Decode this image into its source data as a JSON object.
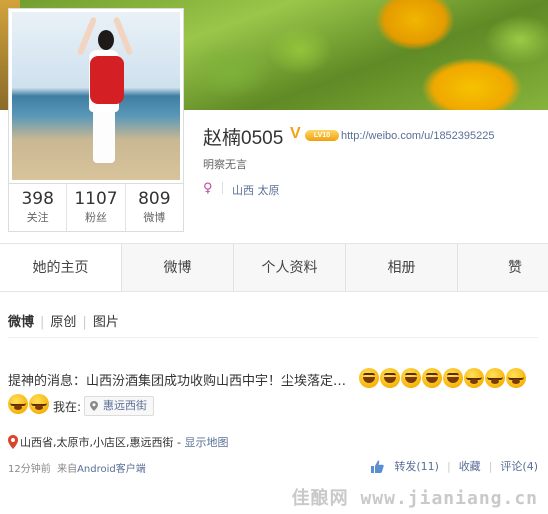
{
  "profile": {
    "username": "赵楠0505",
    "verified_mark": "V",
    "level_badge": "LV10",
    "url": "http://weibo.com/u/1852395225",
    "bio": "明察无言",
    "location": "山西 太原",
    "gender_icon": "female-icon"
  },
  "stats": [
    {
      "value": "398",
      "label": "关注"
    },
    {
      "value": "1107",
      "label": "粉丝"
    },
    {
      "value": "809",
      "label": "微博"
    }
  ],
  "tabs": [
    {
      "label": "她的主页",
      "active": true
    },
    {
      "label": "微博",
      "active": false
    },
    {
      "label": "个人资料",
      "active": false
    },
    {
      "label": "相册",
      "active": false
    },
    {
      "label": "赞",
      "active": false
    }
  ],
  "subtabs": [
    {
      "label": "微博",
      "active": true
    },
    {
      "label": "原创",
      "active": false
    },
    {
      "label": "图片",
      "active": false
    }
  ],
  "post": {
    "text": "提神的消息：山西汾酒集团成功收购山西中宇！尘埃落定…",
    "checkin_label": "我在:",
    "place": "惠远西街",
    "address": "山西省,太原市,小店区,惠远西街",
    "show_map": "显示地图",
    "time": "12分钟前",
    "source_prefix": "来自",
    "source": "Android客户端",
    "emojis_line1": [
      "grin",
      "grin",
      "grin",
      "grin",
      "grin",
      "cry",
      "cry",
      "cry"
    ],
    "emojis_line2": [
      "cry",
      "cry"
    ]
  },
  "actions": {
    "repost": "转发(11)",
    "favorite": "收藏",
    "comment": "评论(4)"
  },
  "watermark": "佳酿网 www.jianiang.cn",
  "colors": {
    "link": "#5a6f96",
    "badge": "#f3a114",
    "gender": "#c24b9a"
  }
}
